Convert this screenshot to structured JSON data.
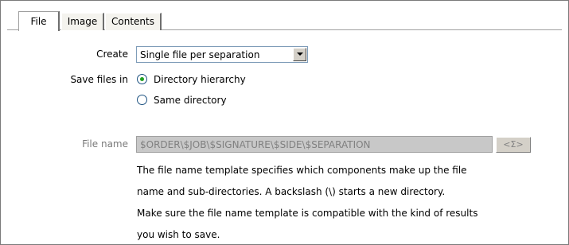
{
  "tabs": [
    {
      "label": "File",
      "active": true
    },
    {
      "label": "Image",
      "active": false
    },
    {
      "label": "Contents",
      "active": false
    }
  ],
  "create": {
    "label": "Create",
    "value": "Single file per separation",
    "icon": "chevron-down-icon"
  },
  "save_files_in": {
    "label": "Save files in",
    "options": [
      {
        "label": "Directory hierarchy",
        "selected": true
      },
      {
        "label": "Same directory",
        "selected": false
      }
    ]
  },
  "file_name": {
    "label": "File name",
    "value": "$ORDER\\$JOB\\$SIGNATURE\\$SIDE\\$SEPARATION",
    "variable_button": "<Σ>"
  },
  "description": [
    "The file name template specifies which components make up the file",
    "name and sub-directories. A backslash (\\) starts a new directory.",
    "Make sure the file name template is compatible with the kind of results",
    "you wish to save."
  ],
  "colors": {
    "radio_dot": "#21a121",
    "disabled_field": "#c8c8c8"
  }
}
